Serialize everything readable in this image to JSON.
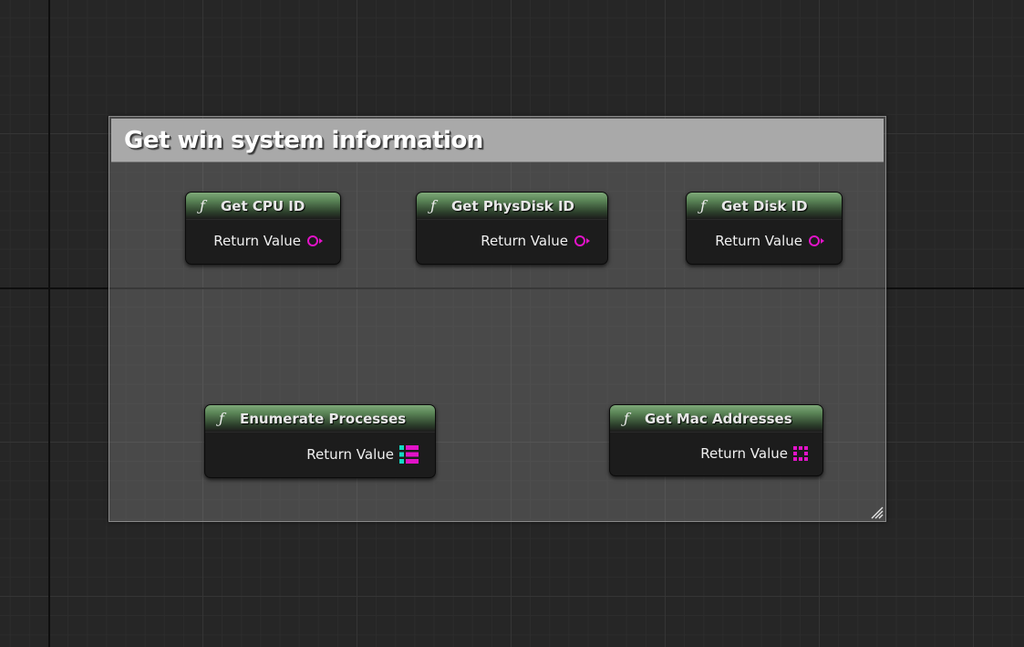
{
  "comment": {
    "title": "Get win system information"
  },
  "nodes": [
    {
      "title": "Get CPU ID",
      "pin_label": "Return Value",
      "pin_type": "string-pin-icon"
    },
    {
      "title": "Get PhysDisk ID",
      "pin_label": "Return Value",
      "pin_type": "string-pin-icon"
    },
    {
      "title": "Get Disk ID",
      "pin_label": "Return Value",
      "pin_type": "string-pin-icon"
    },
    {
      "title": "Enumerate Processes",
      "pin_label": "Return Value",
      "pin_type": "array-pin-icon"
    },
    {
      "title": "Get Mac Addresses",
      "pin_label": "Return Value",
      "pin_type": "array-pin-icon"
    }
  ],
  "icons": {
    "function": "ƒ"
  },
  "colors": {
    "string_pin": "#e213c8",
    "array_pin_primary": "#e213c8",
    "array_pin_secondary": "#14d9c2",
    "node_header": "#5a8456",
    "node_body": "#1c1c1c"
  }
}
